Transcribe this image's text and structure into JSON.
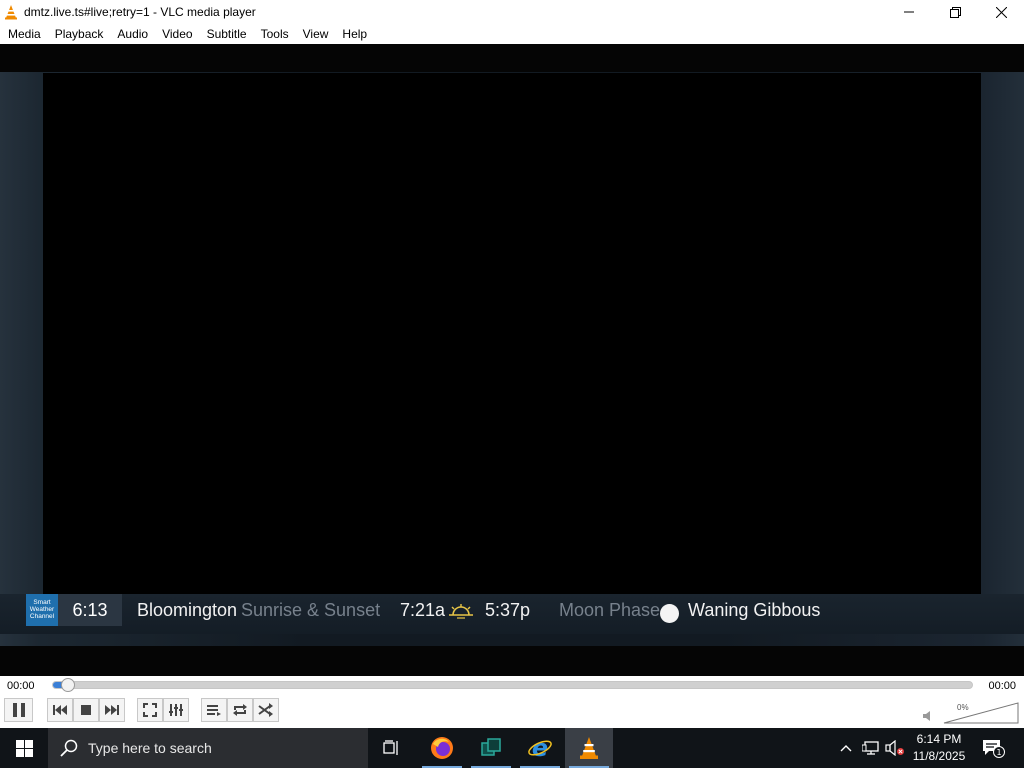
{
  "window": {
    "title": "dmtz.live.ts#live;retry=1 - VLC media player"
  },
  "menu": [
    "Media",
    "Playback",
    "Audio",
    "Video",
    "Subtitle",
    "Tools",
    "View",
    "Help"
  ],
  "video": {
    "logo_lines": [
      "Smart",
      "Weather",
      "Channel"
    ],
    "clock": "6:13",
    "location": "Bloomington",
    "sunrise_sunset_label": "Sunrise & Sunset",
    "sunrise": "7:21a",
    "sunset": "5:37p",
    "moon_phase_label": "Moon Phase",
    "moon_phase": "Waning Gibbous"
  },
  "seek": {
    "elapsed": "00:00",
    "total": "00:00",
    "position_fraction": 0.01
  },
  "volume": {
    "percent_label": "0%",
    "muted": true
  },
  "taskbar": {
    "search_placeholder": "Type here to search",
    "time": "6:14 PM",
    "date": "11/8/2025",
    "notification_count": "1"
  },
  "colors": {
    "accent": "#3b7fd6",
    "vlc_orange": "#f08a00",
    "taskbar": "#101418"
  }
}
